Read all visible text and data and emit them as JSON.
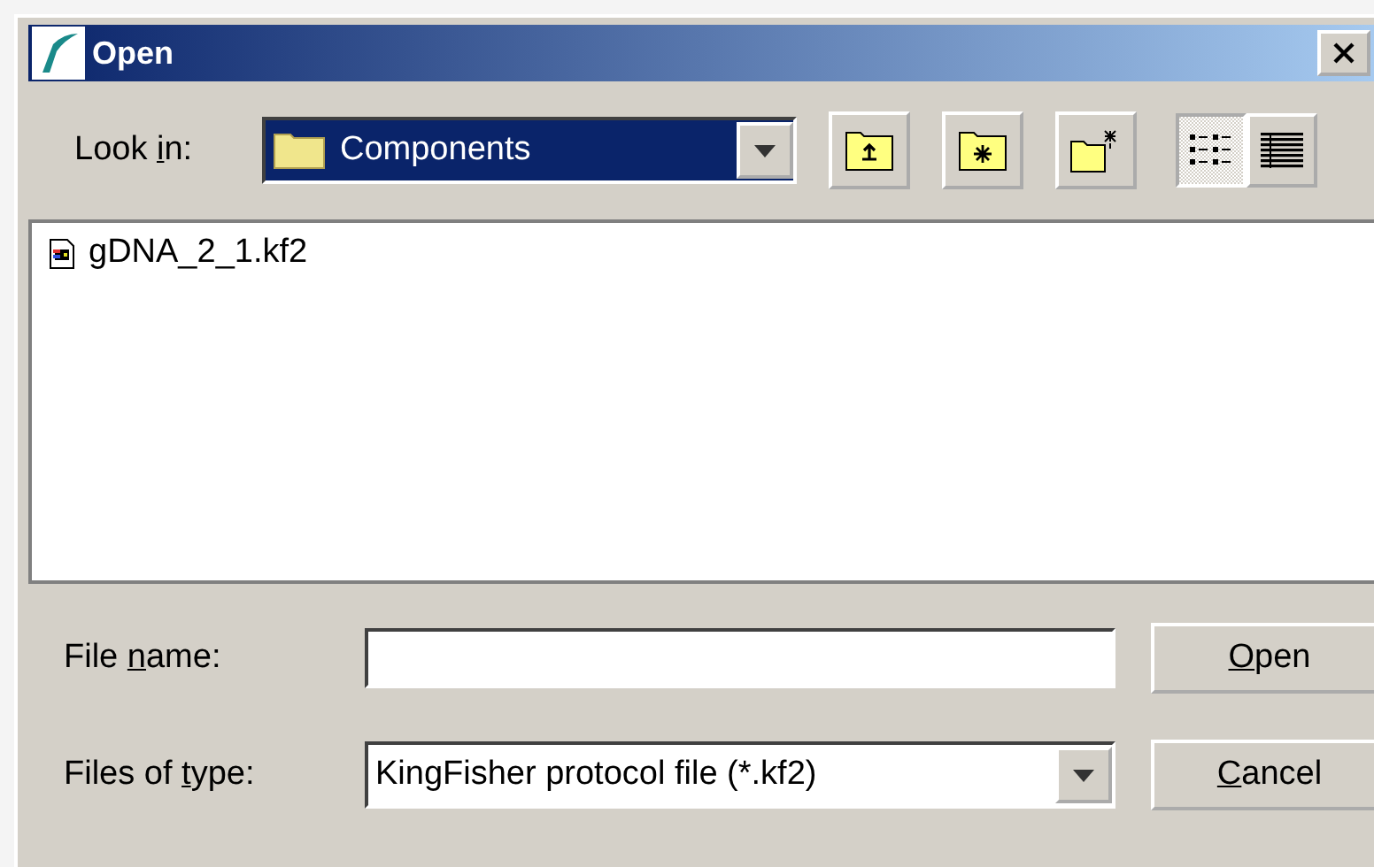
{
  "window": {
    "title": "Open"
  },
  "look_in": {
    "label_parts": [
      "Look ",
      "i",
      "n:"
    ],
    "value": "Components"
  },
  "view_buttons": [
    {
      "kind": "list",
      "selected": true
    },
    {
      "kind": "details",
      "selected": false
    }
  ],
  "files": [
    {
      "name": "gDNA_2_1.kf2"
    }
  ],
  "file_name": {
    "label_parts": [
      "File ",
      "n",
      "ame:"
    ]
  },
  "file_type": {
    "label_parts": [
      "Files of ",
      "t",
      "ype:"
    ],
    "value": "KingFisher protocol file (*.kf2)"
  },
  "buttons": [
    {
      "key": "O",
      "rest": "pen"
    },
    {
      "key": "C",
      "rest": "ancel"
    }
  ]
}
